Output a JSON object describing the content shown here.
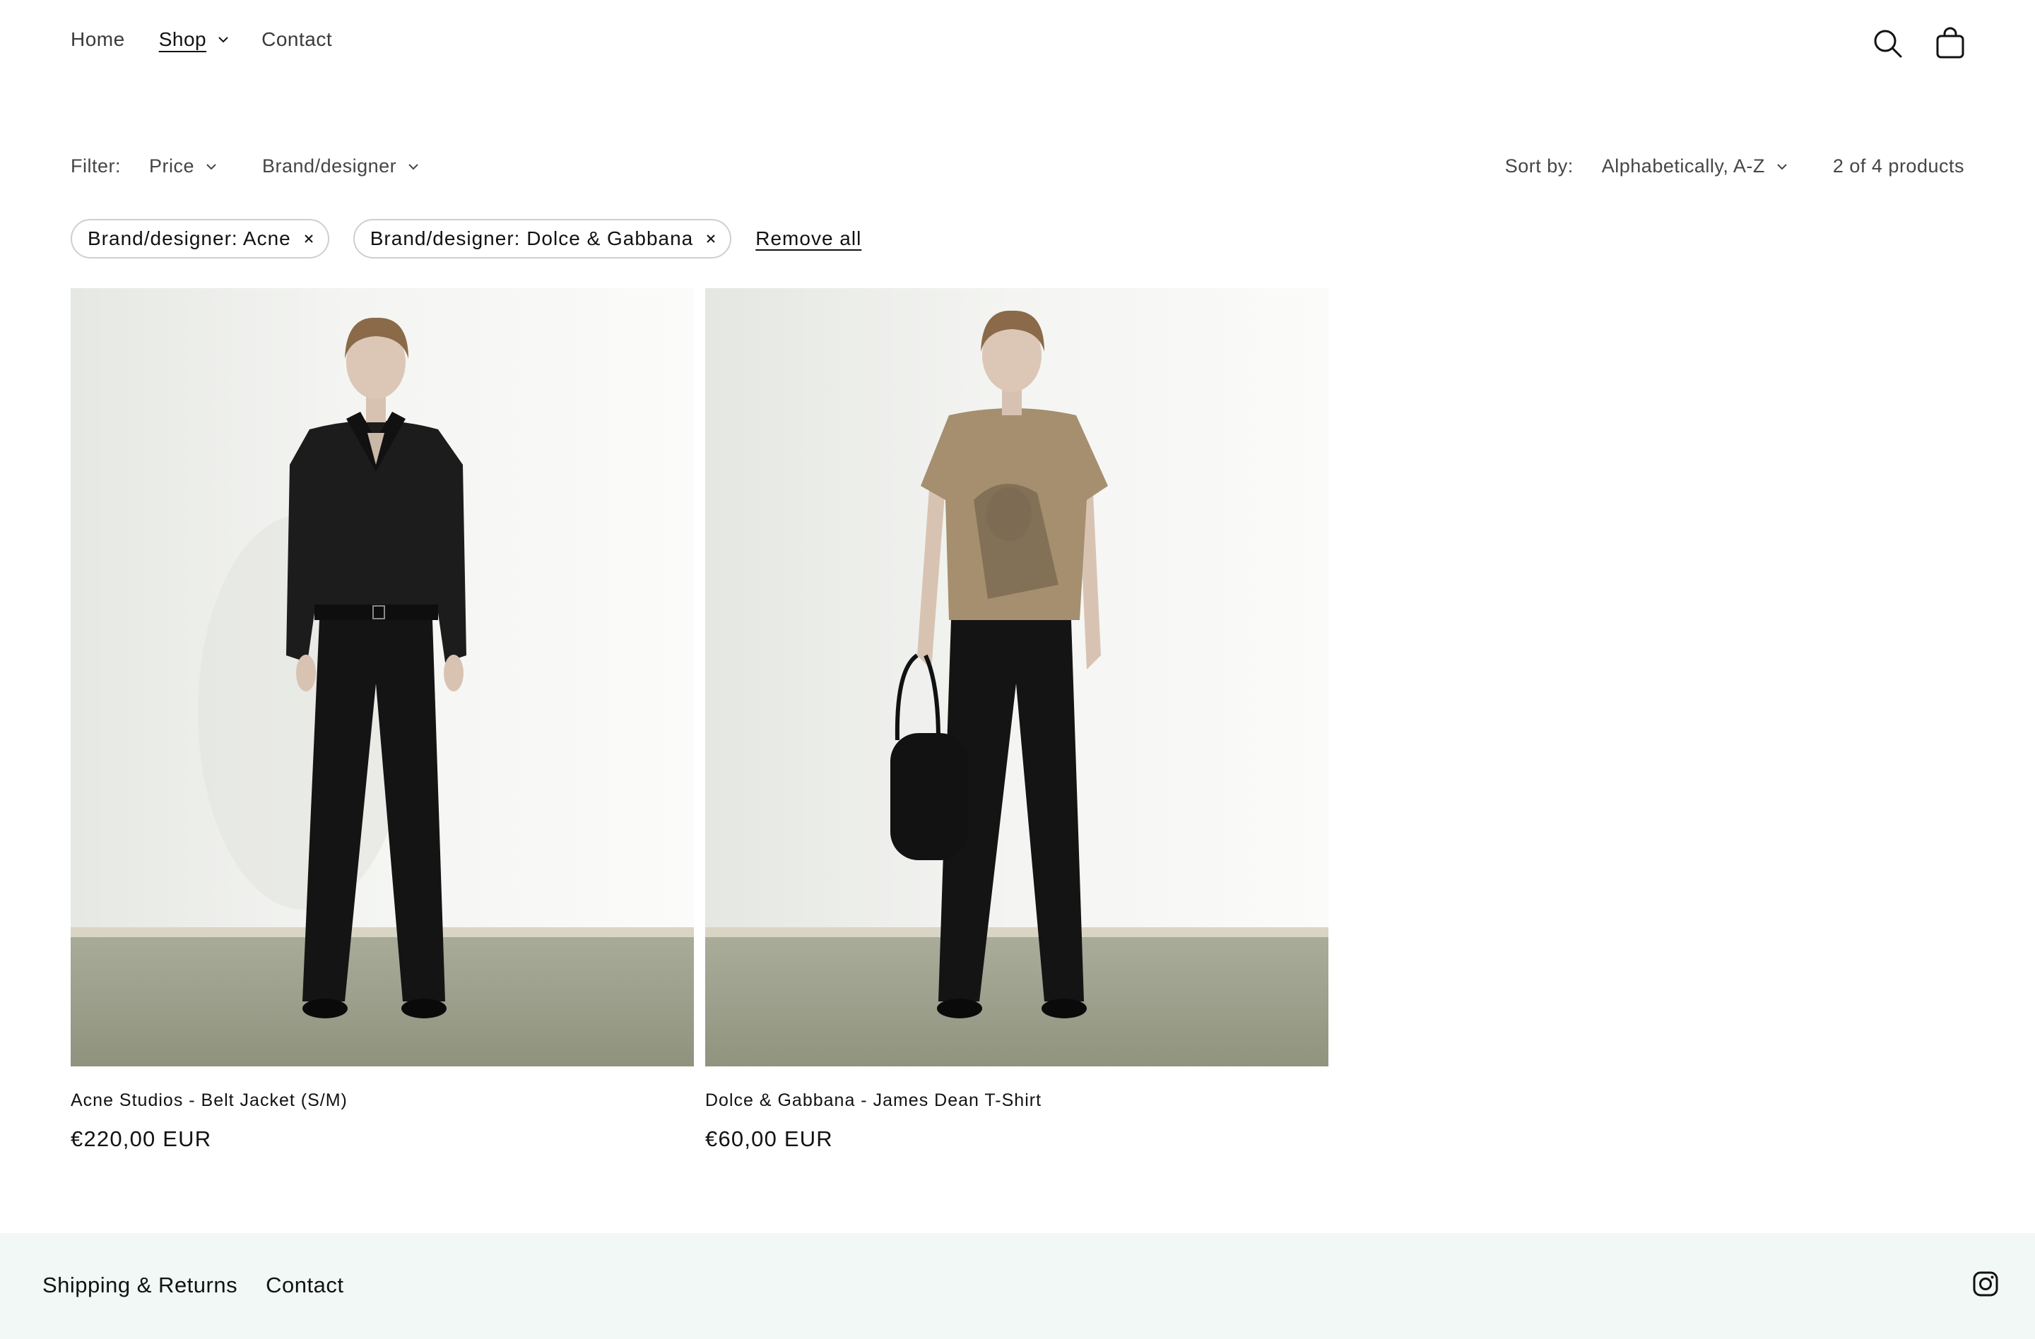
{
  "nav": {
    "items": [
      {
        "label": "Home"
      },
      {
        "label": "Shop"
      },
      {
        "label": "Contact"
      }
    ]
  },
  "header": {
    "icons": [
      "search-icon",
      "cart-icon"
    ]
  },
  "filters": {
    "label": "Filter:",
    "price_label": "Price",
    "brand_label": "Brand/designer",
    "sort_label": "Sort by:",
    "sort_value": "Alphabetically, A-Z",
    "count": "2 of 4 products"
  },
  "active_filters": {
    "chips": [
      {
        "label": "Brand/designer: Acne"
      },
      {
        "label": "Brand/designer: Dolce & Gabbana"
      }
    ],
    "remove_all": "Remove all"
  },
  "products": [
    {
      "title": "Acne Studios - Belt Jacket (S/M)",
      "price": "€220,00 EUR"
    },
    {
      "title": "Dolce & Gabbana - James Dean T-Shirt",
      "price": "€60,00 EUR"
    }
  ],
  "footer": {
    "links": [
      {
        "label": "Shipping & Returns"
      },
      {
        "label": "Contact"
      }
    ],
    "social_icon": "instagram-icon"
  },
  "colors": {
    "text": "#121212",
    "footer_bg": "#f1f8f5",
    "chip_border": "#cfcfcf"
  }
}
